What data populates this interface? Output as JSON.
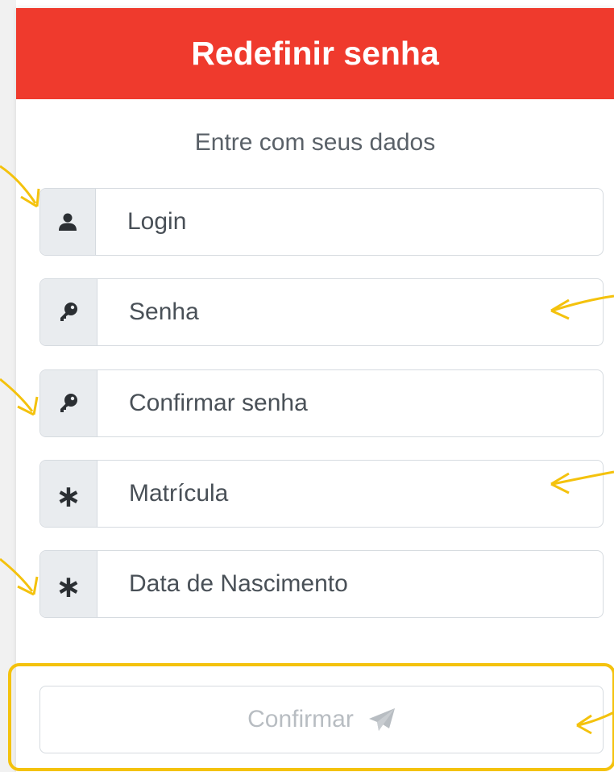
{
  "header": {
    "title": "Redefinir senha",
    "color": "#ef3a2d"
  },
  "form": {
    "subtitle": "Entre com seus dados",
    "fields": [
      {
        "icon": "user-icon",
        "placeholder": "Login"
      },
      {
        "icon": "key-icon",
        "placeholder": "Senha"
      },
      {
        "icon": "key-icon",
        "placeholder": "Confirmar senha"
      },
      {
        "icon": "asterisk-icon",
        "placeholder": "Matrícula"
      },
      {
        "icon": "asterisk-icon",
        "placeholder": "Data de Nascimento"
      }
    ],
    "asterisk_glyph": "∗",
    "submit": {
      "label": "Confirmar",
      "icon": "paper-plane-icon"
    }
  },
  "annotations": {
    "highlight_color": "#f4c20d",
    "arrow_color": "#f4c20d"
  }
}
